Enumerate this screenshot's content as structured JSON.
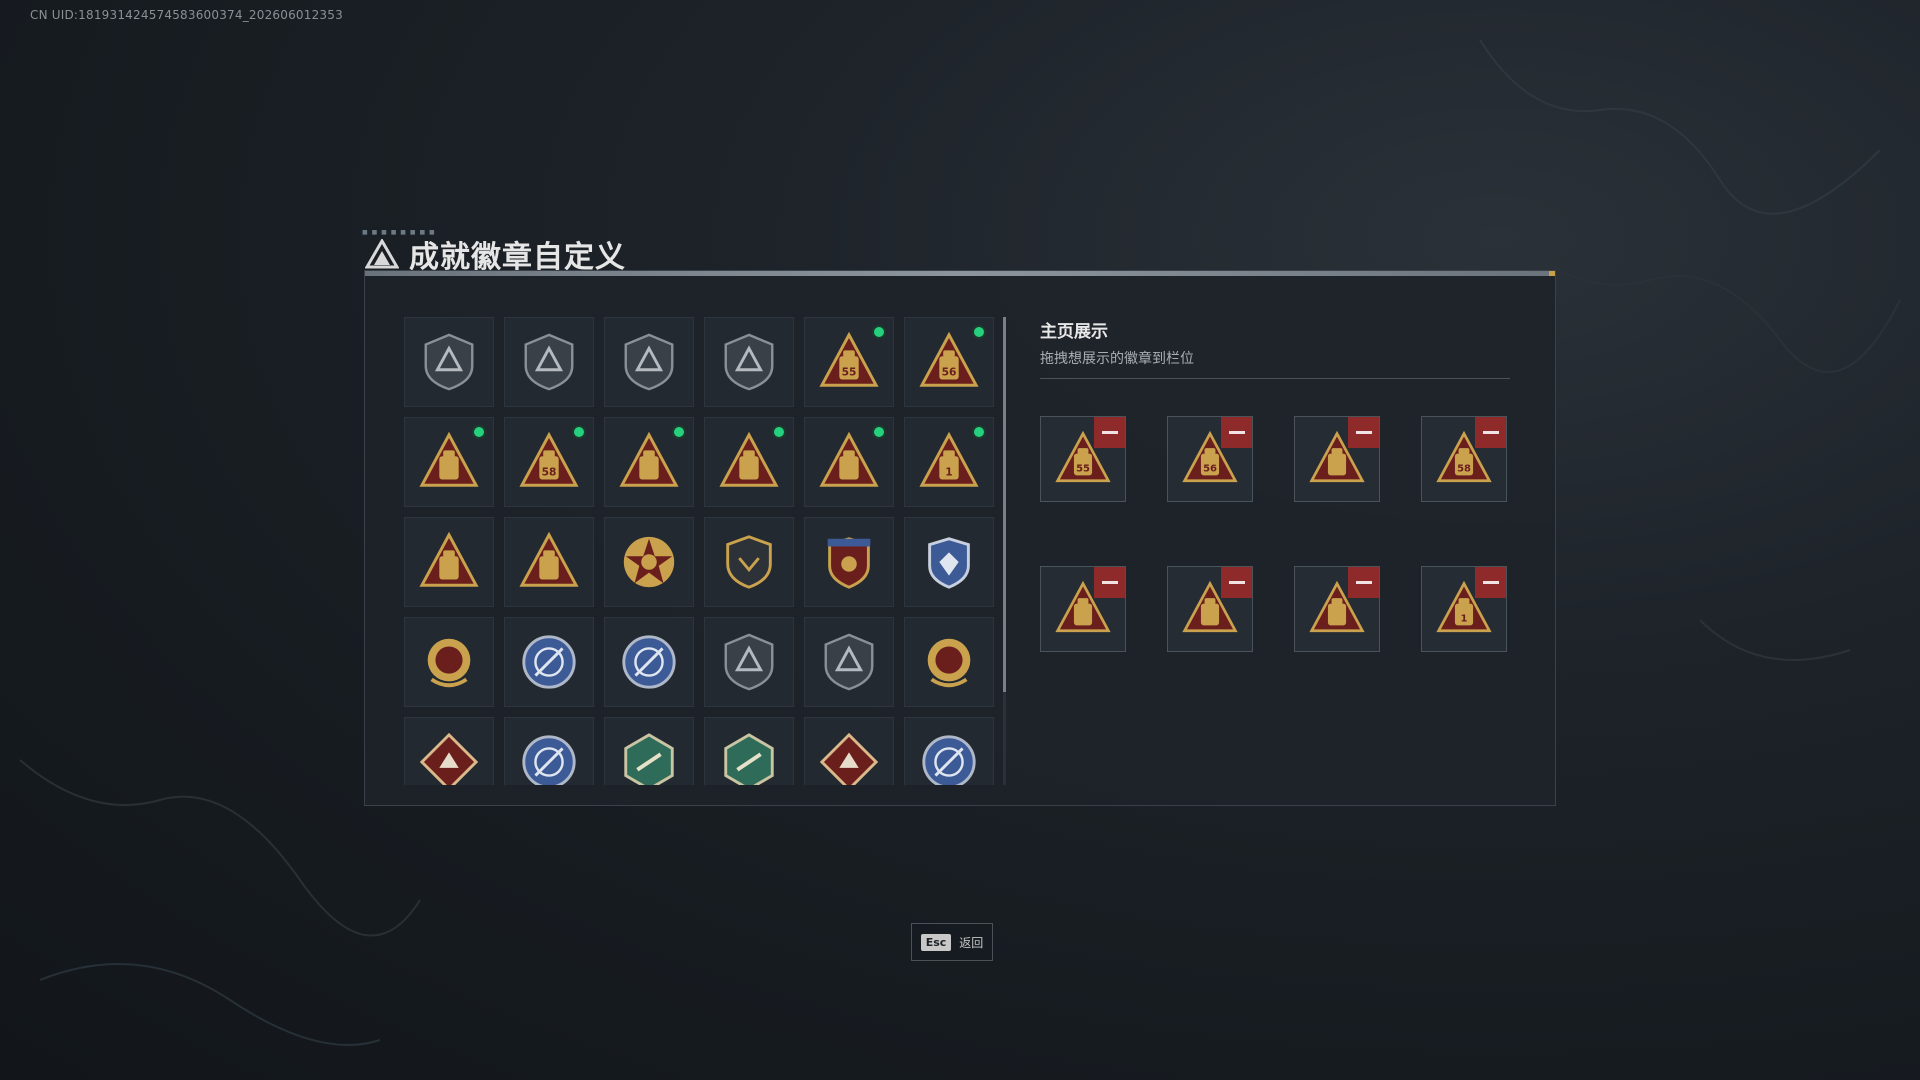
{
  "uid_text": "CN UID:18193142457458360037​4_202606012353",
  "title": "成就徽章自定义",
  "display": {
    "title": "主页展示",
    "subtitle": "拖拽想展示的徽章到栏位"
  },
  "esc": {
    "key": "Esc",
    "label": "返回"
  },
  "colors": {
    "gold": "#caa24e",
    "dark_red": "#6b1f1c",
    "slate": "#4a525a",
    "blue": "#3c5a96",
    "teal": "#2e6b58",
    "new_dot": "#25d07e",
    "remove": "#8e2a2a"
  },
  "badges": [
    {
      "icon": "triangle-emblem-icon",
      "style": "gray-shield",
      "new": false
    },
    {
      "icon": "helicopter-emblem-icon",
      "style": "gray-shield",
      "new": false
    },
    {
      "icon": "diamond-emblem-icon",
      "style": "gray-shield",
      "new": false
    },
    {
      "icon": "blade-emblem-icon",
      "style": "gray-shield",
      "new": false
    },
    {
      "icon": "backpack-55-icon",
      "style": "gold-triangle",
      "label": "55",
      "new": true
    },
    {
      "icon": "cat-56-icon",
      "style": "gold-triangle",
      "label": "56",
      "new": true
    },
    {
      "icon": "device-57-icon",
      "style": "gold-triangle",
      "label": "",
      "new": true
    },
    {
      "icon": "case-58-icon",
      "style": "gold-triangle",
      "label": "58",
      "new": true
    },
    {
      "icon": "robot-icon",
      "style": "gold-triangle",
      "label": "",
      "new": true
    },
    {
      "icon": "hand-sign-icon",
      "style": "gold-triangle",
      "label": "",
      "new": true
    },
    {
      "icon": "boat-icon",
      "style": "gold-triangle",
      "label": "",
      "new": true
    },
    {
      "icon": "number-one-icon",
      "style": "gold-triangle",
      "label": "1",
      "new": true
    },
    {
      "icon": "supply-box-icon",
      "style": "gold-triangle",
      "label": "",
      "new": false
    },
    {
      "icon": "ruins-icon",
      "style": "gold-triangle",
      "label": "",
      "new": false
    },
    {
      "icon": "star-cross-icon",
      "style": "red-star",
      "new": false
    },
    {
      "icon": "gold-shield-icon",
      "style": "gold-shield",
      "new": false
    },
    {
      "icon": "red-crest-icon",
      "style": "red-crest",
      "new": false
    },
    {
      "icon": "blue-crest-icon",
      "style": "blue-crest",
      "new": false
    },
    {
      "icon": "laurel-medal-icon",
      "style": "gold-medal",
      "new": false
    },
    {
      "icon": "rifle-blue-crest-icon",
      "style": "blue-round",
      "new": false
    },
    {
      "icon": "rifle-blue-crest-2-icon",
      "style": "blue-round",
      "new": false
    },
    {
      "icon": "crosshair-shield-icon",
      "style": "gray-shield",
      "new": false
    },
    {
      "icon": "crosshair-shield-2-icon",
      "style": "gray-shield",
      "new": false
    },
    {
      "icon": "gold-crossed-guns-icon",
      "style": "gold-medal",
      "new": false
    },
    {
      "icon": "wolf-red-icon",
      "style": "red-diamond",
      "new": false
    },
    {
      "icon": "eagle-blue-icon",
      "style": "blue-round",
      "new": false
    },
    {
      "icon": "dragon-teal-icon",
      "style": "teal-hex",
      "new": false
    },
    {
      "icon": "gun-teal-icon",
      "style": "teal-hex",
      "new": false
    },
    {
      "icon": "dragon-red-icon",
      "style": "red-diamond",
      "new": false
    },
    {
      "icon": "wolf-blue-icon",
      "style": "blue-round",
      "new": false
    }
  ],
  "slots": [
    {
      "icon": "backpack-55-icon",
      "label": "55"
    },
    {
      "icon": "cat-56-icon",
      "label": "56"
    },
    {
      "icon": "device-57-icon",
      "label": ""
    },
    {
      "icon": "case-58-icon",
      "label": "58"
    },
    {
      "icon": "robot-icon",
      "label": ""
    },
    {
      "icon": "hand-sign-icon",
      "label": ""
    },
    {
      "icon": "boat-icon",
      "label": ""
    },
    {
      "icon": "number-one-icon",
      "label": "1"
    }
  ]
}
